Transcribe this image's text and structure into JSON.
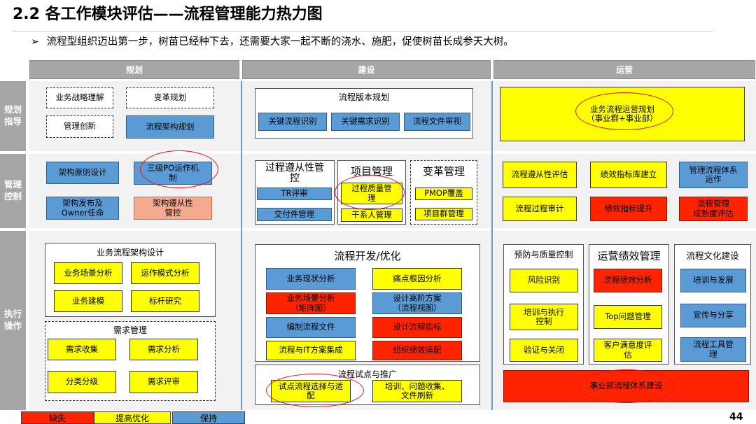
{
  "page": {
    "title": "2.2 各工作模块评估——流程管理能力热力图",
    "subtitle_bullet": "➢",
    "subtitle": "流程型组织迈出第一步，树苗已经种下去，还需要大家一起不断的浇水、施肥，促使树苗长成参天大树。",
    "page_number": "44"
  },
  "columns": {
    "plan": "规划",
    "build": "建设",
    "operate": "运营"
  },
  "rows": {
    "guide": "规划\n指导",
    "control": "管理\n控制",
    "execute": "执行\n操作"
  },
  "guide": {
    "plan": {
      "biz_strategy": "业务战略理解",
      "change_plan": "变革规划",
      "mgmt_innov": "管理创新",
      "arch_plan": "流程架构规划"
    },
    "build": {
      "group_title": "流程版本规划",
      "key_flow": "关键流程识别",
      "key_req": "关键需求识别",
      "doc_review": "流程文件审视"
    },
    "operate": {
      "ops_plan": "业务流程运营规划\n（事业群+事业部）"
    }
  },
  "control": {
    "plan": {
      "arch_design": "架构原则设计",
      "po_mech": "三级PO运作机\n制",
      "arch_release": "架构发布及\nOwner任命",
      "arch_comply": "架构遵从性\n管控"
    },
    "build": {
      "proc_title": "过程遵从性管\n控",
      "tr_review": "TR评审",
      "deliv_mgmt": "交付件管理",
      "proj_title": "项目管理",
      "proc_quality": "过程质量管\n理",
      "stakeholder": "干系人管理",
      "change_title": "变革管理",
      "pmop": "PMOP覆盖",
      "portfolio": "项目群管理"
    },
    "operate": {
      "comply_eval": "流程遵从性评估",
      "kpi_lib": "绩效指标库建立",
      "sys_ops": "管理流程体系\n运作",
      "audit": "流程过程审计",
      "kpi_up": "绩效指标提升",
      "maturity": "流程管理\n成熟度评估"
    }
  },
  "execute": {
    "plan": {
      "arch_title": "业务流程架构设计",
      "scene_analysis": "业务场景分析",
      "op_mode": "运作模式分析",
      "biz_model": "业务建模",
      "benchmark": "标杆研究",
      "req_title": "需求管理",
      "req_collect": "需求收集",
      "req_analysis": "需求分析",
      "classify": "分类分级",
      "req_review": "需求评审"
    },
    "build": {
      "dev_title": "流程开发/优化",
      "status_analysis": "业务现状分析",
      "root_cause": "痛点根因分析",
      "scene_matrix": "业务场景分析\n（矩阵图）",
      "high_level": "设计高阶方案\n（流程视图）",
      "compile_docs": "编制流程文件",
      "design_kpi": "设计流程指标",
      "it_integrate": "流程与IT方案集成",
      "org_fit": "组织绩效适配",
      "pilot_title": "流程试点与推广",
      "pilot_select": "试点流程选择与适\n配",
      "training": "培训、问题收集、\n文件刷新"
    },
    "operate": {
      "risk_title": "预防与质量控制",
      "risk_id": "风险识别",
      "train_exec": "培训与执行\n控制",
      "verify_close": "验证与关闭",
      "perf_title": "运营绩效管理",
      "perf_analysis": "流程绩效分析",
      "top_issue": "Top问题管理",
      "satisfaction": "客户满意度评\n估",
      "culture_title": "流程文化建设",
      "train_dev": "培训与发展",
      "promote_share": "宣传与分享",
      "tool_mgmt": "流程工具管\n理",
      "bu_system": "事业部流程体系建设"
    }
  },
  "legend": {
    "missing": "缺失",
    "improve": "提高优化",
    "keep": "保持"
  },
  "colors": {
    "missing": "#ff2400",
    "improve": "#ffff00",
    "keep": "#5b9bd5",
    "header_gray": "#a6a6a6",
    "band_gray": "#f2f2f2",
    "column_separator": "#6a9ad0",
    "highlight_circle": "#e8121a"
  }
}
